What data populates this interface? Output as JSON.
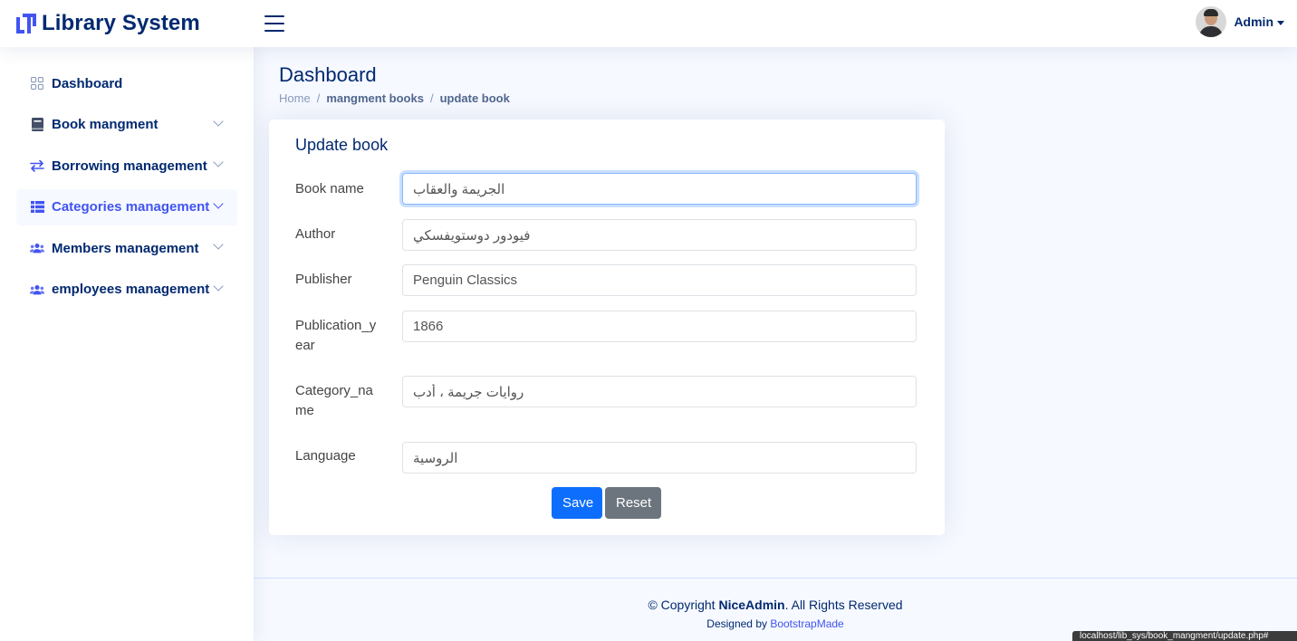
{
  "header": {
    "logo_text": "Library System",
    "menu_toggle_icon": "hamburger-icon",
    "profile": {
      "name": "Admin"
    }
  },
  "sidebar": {
    "items": [
      {
        "label": "Dashboard",
        "icon": "grid-icon"
      },
      {
        "label": "Book mangment",
        "icon": "book-icon"
      },
      {
        "label": "Borrowing management",
        "icon": "arrows-exchange-icon"
      },
      {
        "label": "Categories management",
        "icon": "list-icon",
        "active": true
      },
      {
        "label": "Members management",
        "icon": "people-icon"
      },
      {
        "label": "employees management",
        "icon": "people-icon"
      }
    ]
  },
  "page": {
    "title": "Dashboard",
    "breadcrumb": [
      "Home",
      "mangment books",
      "update book"
    ]
  },
  "form": {
    "title": "Update book",
    "fields": [
      {
        "label": "Book name",
        "value": "الجريمة والعقاب"
      },
      {
        "label": "Author",
        "value": "فيودور دوستويفسكي"
      },
      {
        "label": "Publisher",
        "value": "Penguin Classics"
      },
      {
        "label": "Publication_y\near",
        "value": "1866"
      },
      {
        "label": "Category_na\nme",
        "value": "روايات جريمة ، أدب"
      },
      {
        "label": "Language",
        "value": "الروسية"
      }
    ],
    "save_label": "Save",
    "reset_label": "Reset"
  },
  "footer": {
    "copyright_prefix": "© Copyright ",
    "brand": "NiceAdmin",
    "copyright_suffix": ". All Rights Reserved",
    "designed_by": "Designed by ",
    "designer": "BootstrapMade"
  },
  "status_url": "localhost/lib_sys/book_mangment/update.php#",
  "colors": {
    "primary": "#4154f1",
    "navy": "#012970",
    "save_button": "#0d6efd",
    "reset_button": "#6c757d",
    "background": "#f6f9ff"
  }
}
